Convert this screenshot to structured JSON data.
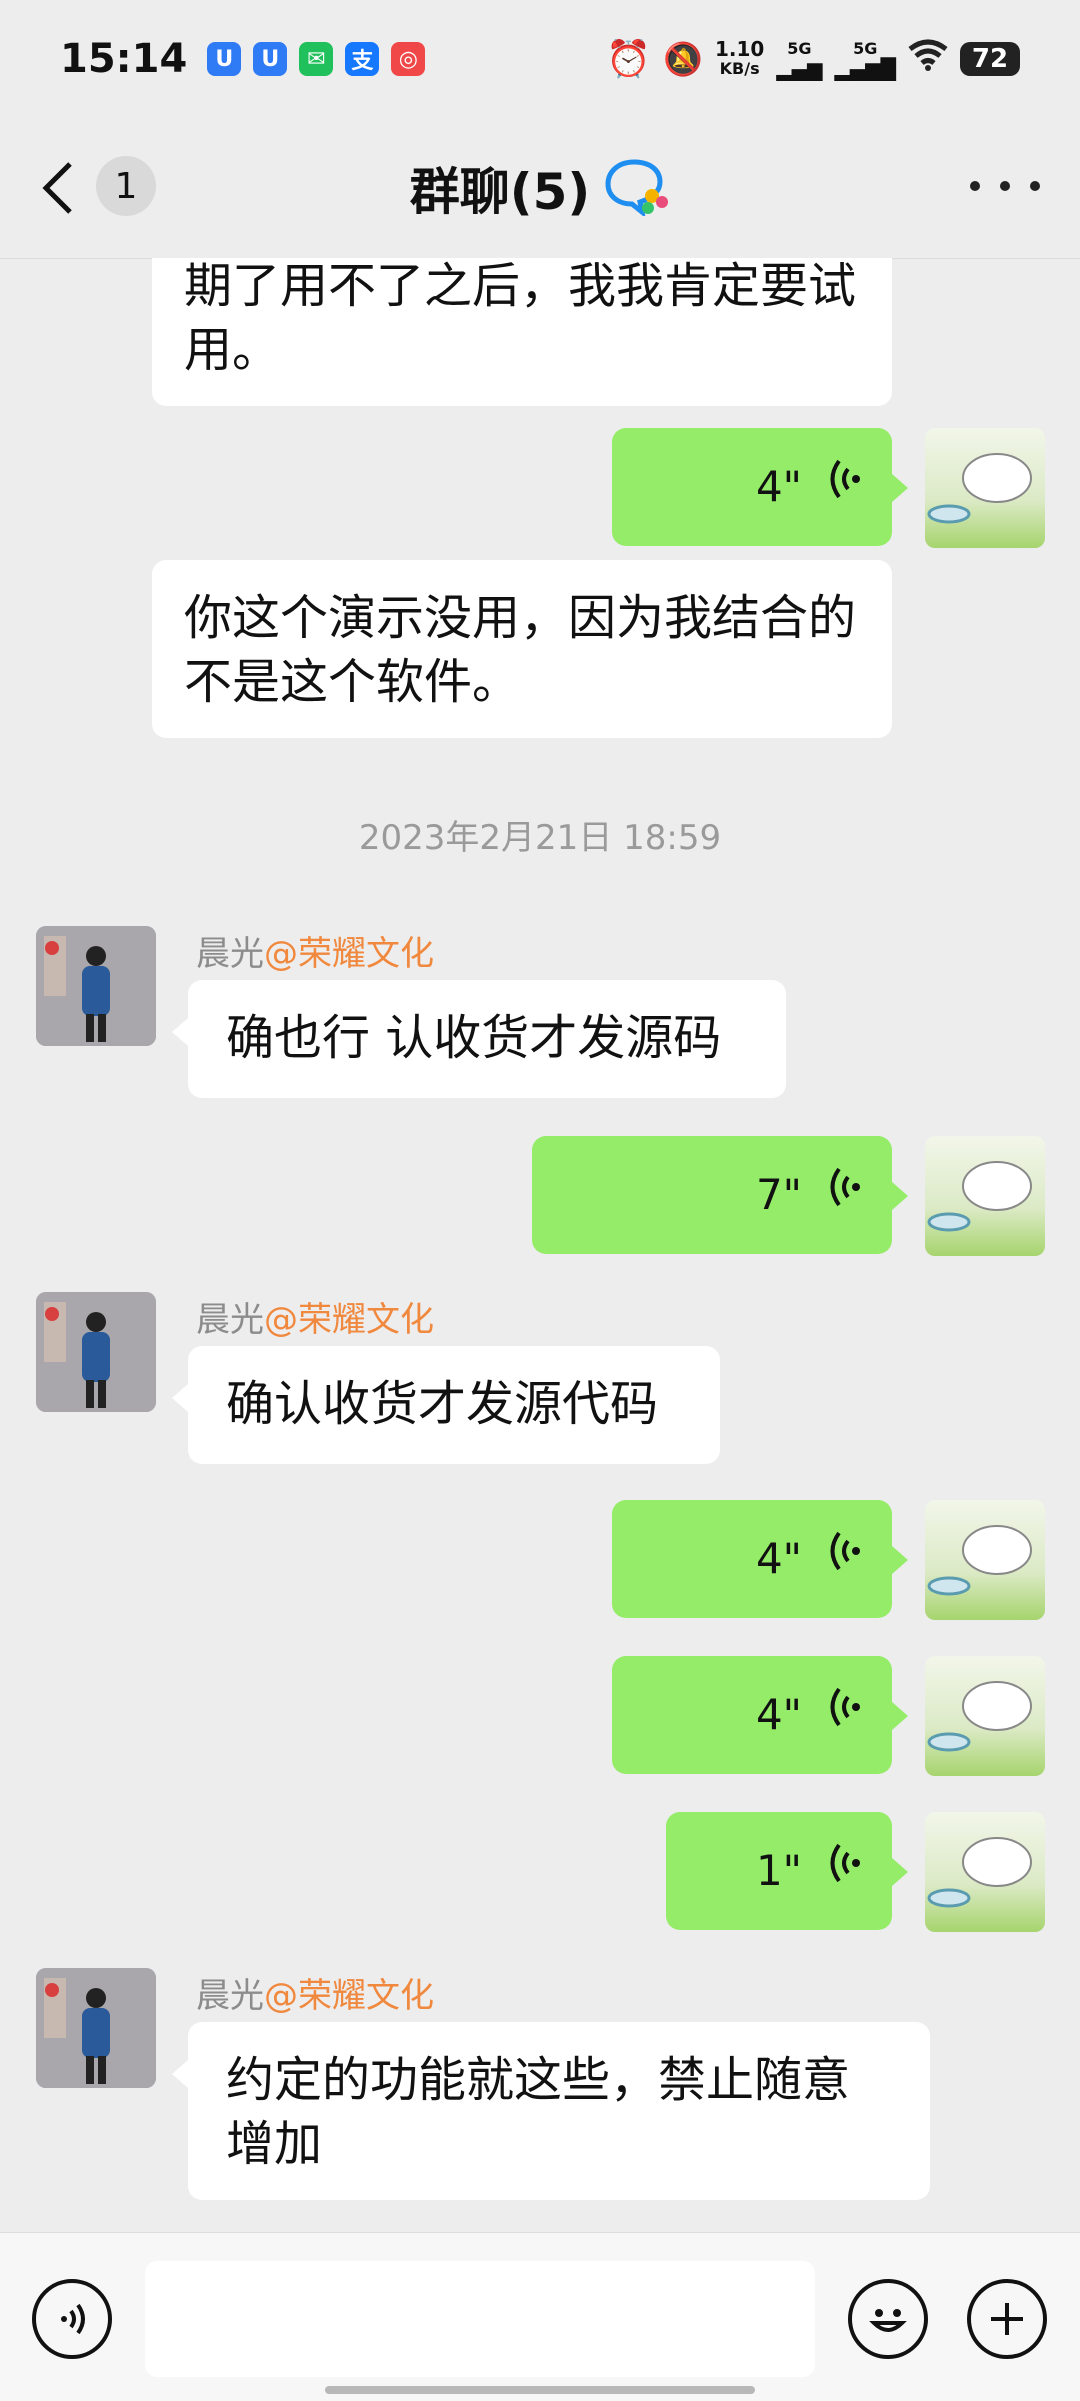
{
  "status": {
    "time": "15:14",
    "net_speed": "1.10",
    "net_unit": "KB/s",
    "sig1": "5G",
    "sig2": "5G",
    "battery": "72"
  },
  "header": {
    "back_count": "1",
    "title": "群聊(5)"
  },
  "messages": {
    "m1": "期了用不了之后，我我肯定要试用。",
    "v1": "4\"",
    "m2": "你这个演示没用，因为我结合的不是这个软件。",
    "timestamp": "2023年2月21日 18:59",
    "sender_name": "晨光",
    "sender_tag": "@荣耀文化",
    "m3": "确也行 认收货才发源码",
    "v2": "7\"",
    "m4": "确认收货才发源代码",
    "v3": "4\"",
    "v4": "4\"",
    "v5": "1\"",
    "m5": "约定的功能就这些，禁止随意增加"
  },
  "colors": {
    "green_bubble": "#95ec69",
    "accent_tag": "#f0883e",
    "background": "#ededed"
  }
}
